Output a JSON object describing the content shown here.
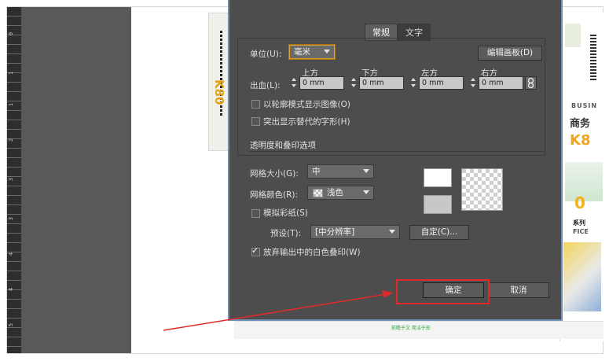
{
  "ruler": {
    "ticks": [
      "0",
      "1",
      "1",
      "2",
      "3",
      "3",
      "4",
      "4",
      "5"
    ]
  },
  "dialog": {
    "tabs": [
      {
        "label": "常规",
        "active": true
      },
      {
        "label": "文字",
        "active": false
      }
    ],
    "unit_label": "单位(U):",
    "unit_value": "毫米",
    "edit_artboard_button": "编辑画板(D)",
    "bleed_label": "出血(L):",
    "bleed_columns": [
      {
        "label": "上方",
        "value": "0 mm"
      },
      {
        "label": "下方",
        "value": "0 mm"
      },
      {
        "label": "左方",
        "value": "0 mm"
      },
      {
        "label": "右方",
        "value": "0 mm"
      }
    ],
    "outline_mode_label": "以轮廓模式显示图像(O)",
    "outline_mode_checked": false,
    "highlight_glyphs_label": "突出显示替代的字形(H)",
    "highlight_glyphs_checked": false,
    "transparency_section_title": "透明度和叠印选项",
    "grid_size_label": "网格大小(G):",
    "grid_size_value": "中",
    "grid_color_label": "网格颜色(R):",
    "grid_color_value": "浅色",
    "simulate_paper_label": "模拟彩纸(S)",
    "simulate_paper_checked": false,
    "preset_label": "预设(T):",
    "preset_value": "[中分辨率]",
    "custom_button": "自定(C)...",
    "discard_white_overprint_label": "放弃输出中的白色叠印(W)",
    "discard_white_overprint_checked": true,
    "ok_button": "确定",
    "cancel_button": "取消"
  },
  "artwork": {
    "k80_text": "K80",
    "footer_text": "前瞻于文 简洁于形",
    "right_texts": [
      "商务",
      "K8",
      "系列",
      "FICE",
      "BUSIN"
    ]
  },
  "colors": {
    "dialog_bg": "#4d4d4d",
    "dialog_border": "#6f8fb4",
    "annotation_red": "#e02a2a",
    "unit_focus": "#e0a030"
  }
}
